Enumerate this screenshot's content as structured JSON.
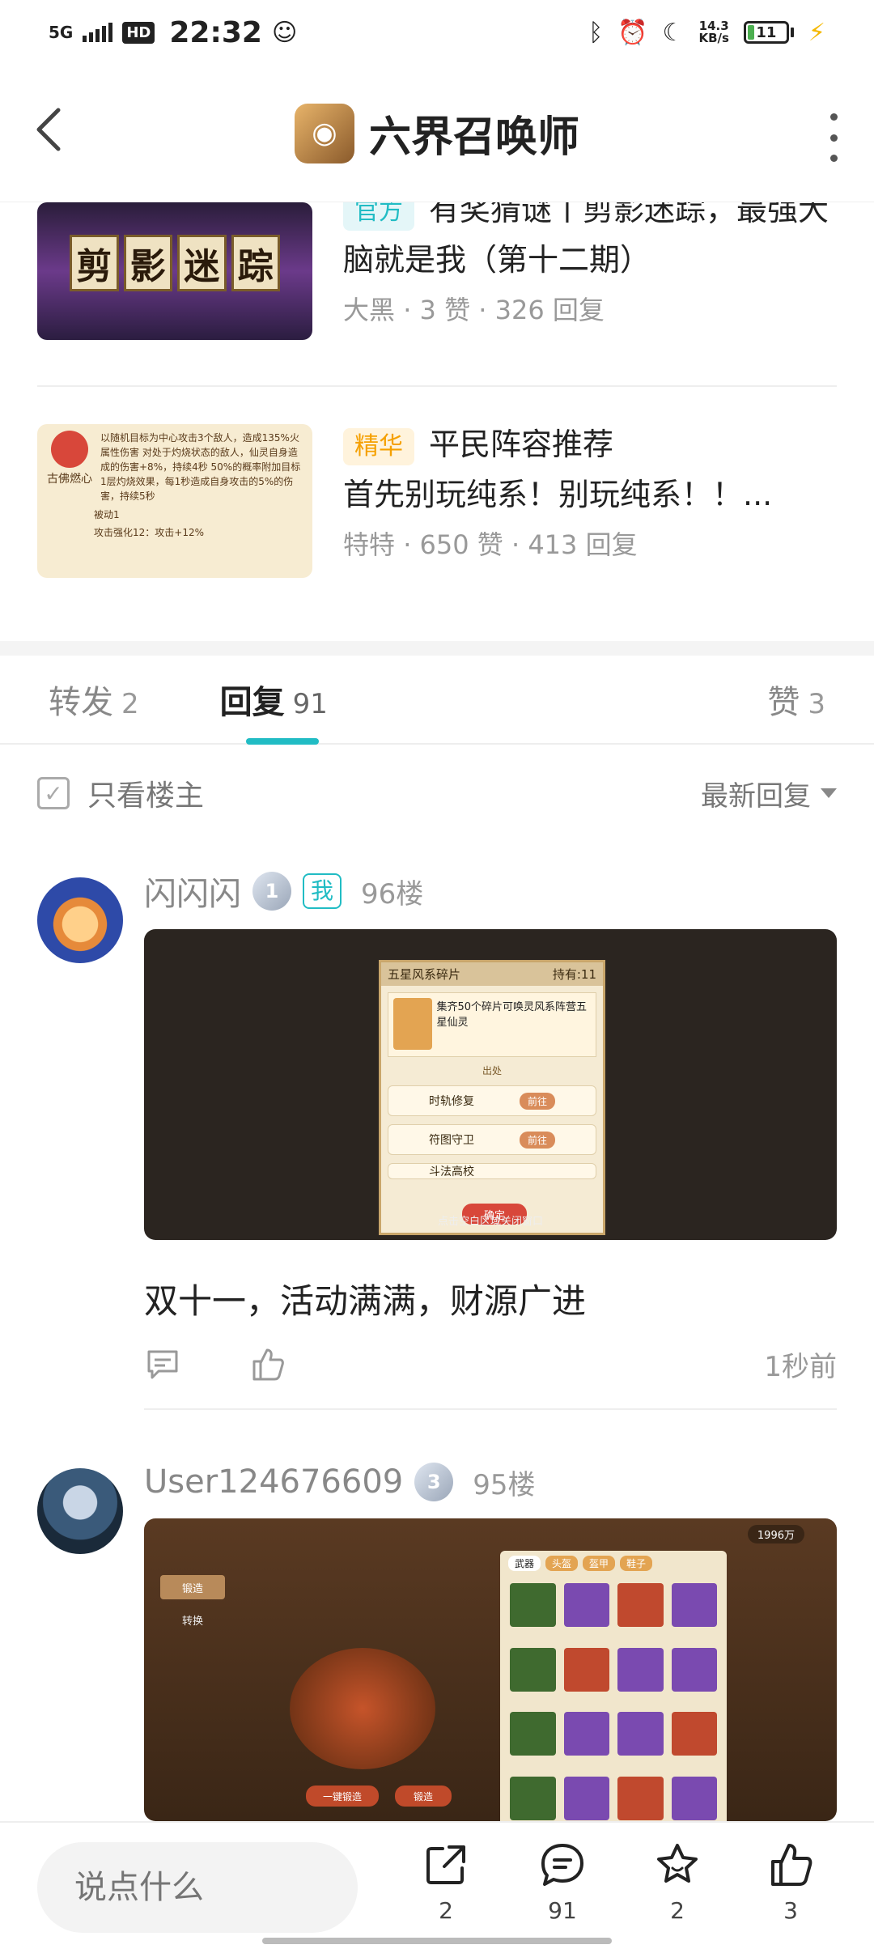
{
  "status_bar": {
    "network": "5G",
    "hd": "HD",
    "time": "22:32",
    "speed_value": "14.3",
    "speed_unit": "KB/s",
    "battery": "11"
  },
  "header": {
    "title": "六界召唤师"
  },
  "related_posts": [
    {
      "tag": "官方",
      "title": "有奖猜谜丨剪影迷踪，最强大脑就是我（第十二期）",
      "thumb_text": [
        "剪",
        "影",
        "迷",
        "踪"
      ],
      "author": "大黑",
      "likes": "3 赞",
      "replies": "326 回复"
    },
    {
      "tag": "精华",
      "title_line1": "平民阵容推荐",
      "title_line2": "首先别玩纯系！别玩纯系！！...",
      "thumb_label": "古佛燃心",
      "thumb_text": "以随机目标为中心攻击3个敌人，造成135%火属性伤害 对处于灼烧状态的敌人，仙灵自身造成的伤害+8%，持续4秒 50%的概率附加目标1层灼烧效果，每1秒造成自身攻击的5%的伤害，持续5秒",
      "thumb_passive": "被动1",
      "thumb_bonus": "攻击强化12：攻击+12%",
      "author": "特特",
      "likes": "650 赞",
      "replies": "413 回复"
    }
  ],
  "tabs": {
    "forward_label": "转发",
    "forward_count": "2",
    "reply_label": "回复",
    "reply_count": "91",
    "like_label": "赞",
    "like_count": "3"
  },
  "filter": {
    "only_owner": "只看楼主",
    "sort": "最新回复"
  },
  "comments": [
    {
      "user": "闪闪闪",
      "me_badge": "我",
      "floor": "96楼",
      "level": "1",
      "img_title": "五星风系碎片",
      "img_hold": "持有:11",
      "img_desc": "集齐50个碎片可唤灵风系阵营五星仙灵",
      "img_section": "出处",
      "img_rows": [
        "时轨修复",
        "符图守卫",
        "斗法高校"
      ],
      "img_go": "前往",
      "img_confirm": "确定",
      "img_footer": "点击空白区域关闭窗口",
      "text": "双十一，活动满满，财源广进",
      "time": "1秒前"
    },
    {
      "user": "User124676609",
      "floor": "95楼",
      "level": "3",
      "img_tabs": [
        "武器",
        "头盔",
        "盔甲",
        "鞋子"
      ],
      "img_gold": "1996万",
      "img_forge": "锻造",
      "img_switch": "转换",
      "img_one_click": "一键锻造",
      "img_forge_btn": "锻造"
    }
  ],
  "bottom_bar": {
    "placeholder": "说点什么",
    "share_count": "2",
    "comment_count": "91",
    "fav_count": "2",
    "like_count": "3"
  },
  "colors": {
    "accent": "#21bcc4",
    "essence": "#f5a000"
  }
}
